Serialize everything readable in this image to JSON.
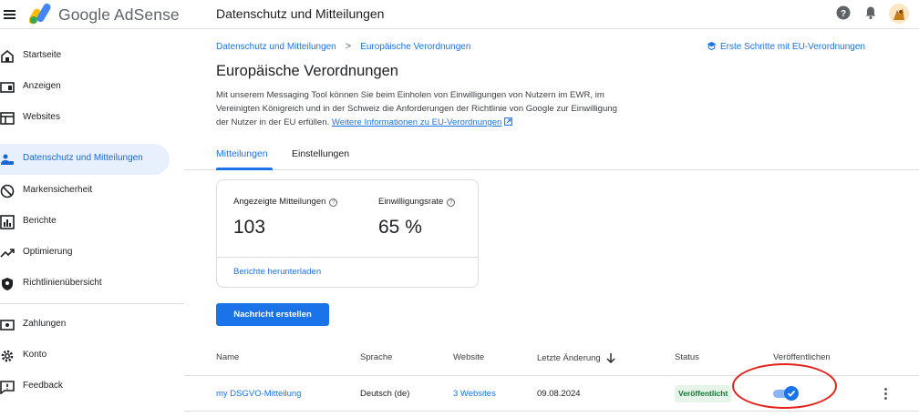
{
  "header": {
    "brand": "Google AdSense",
    "app_title": "Datenschutz und Mitteilungen",
    "icons": [
      "menu-icon",
      "adsense-logo",
      "help-icon",
      "bell-icon",
      "avatar"
    ]
  },
  "sidebar": {
    "items": [
      {
        "label": "Startseite",
        "icon": "home-icon"
      },
      {
        "label": "Anzeigen",
        "icon": "ads-icon"
      },
      {
        "label": "Websites",
        "icon": "websites-icon"
      },
      {
        "label": "Datenschutz und Mitteilungen",
        "icon": "privacy-icon",
        "active": true
      },
      {
        "label": "Markensicherheit",
        "icon": "block-icon"
      },
      {
        "label": "Berichte",
        "icon": "reports-icon"
      },
      {
        "label": "Optimierung",
        "icon": "trending-icon"
      },
      {
        "label": "Richtlinienübersicht",
        "icon": "shield-icon"
      },
      {
        "label": "Zahlungen",
        "icon": "payments-icon"
      },
      {
        "label": "Konto",
        "icon": "gear-icon"
      },
      {
        "label": "Feedback",
        "icon": "feedback-icon"
      }
    ]
  },
  "breadcrumb": {
    "parent": "Datenschutz und Mitteilungen",
    "separator": ">",
    "current": "Europäische Verordnungen"
  },
  "eu_help_link": "Erste Schritte mit EU-Verordnungen",
  "page": {
    "title": "Europäische Verordnungen",
    "description": "Mit unserem Messaging Tool können Sie beim Einholen von Einwilligungen von Nutzern im EWR, im Vereinigten Königreich und in der Schweiz die Anforderungen der Richtlinie von Google zur Einwilligung der Nutzer in der EU erfüllen.",
    "more_link": "Weitere Informationen zu EU-Verordnungen"
  },
  "tabs": [
    {
      "label": "Mitteilungen",
      "active": true
    },
    {
      "label": "Einstellungen",
      "active": false
    }
  ],
  "stats": {
    "shown_label": "Angezeigte Mitteilungen",
    "shown_value": "103",
    "consent_label": "Einwilligungsrate",
    "consent_value": "65 %",
    "download_link": "Berichte herunterladen"
  },
  "create_button": "Nachricht erstellen",
  "table": {
    "columns": [
      "Name",
      "Sprache",
      "Website",
      "Letzte Änderung",
      "Status",
      "Veröffentlichen"
    ],
    "rows": [
      {
        "name": "my DSGVO-Mitteilung",
        "language": "Deutsch (de)",
        "website": "3 Websites",
        "last_modified": "09.08.2024",
        "status": "Veröffentlicht",
        "published": true
      }
    ]
  },
  "colors": {
    "accent": "#1a73e8",
    "active_nav_bg": "#e8f0fe",
    "status_bg": "#e6f4ea",
    "status_text": "#137333",
    "annotation": "#e8201a"
  }
}
